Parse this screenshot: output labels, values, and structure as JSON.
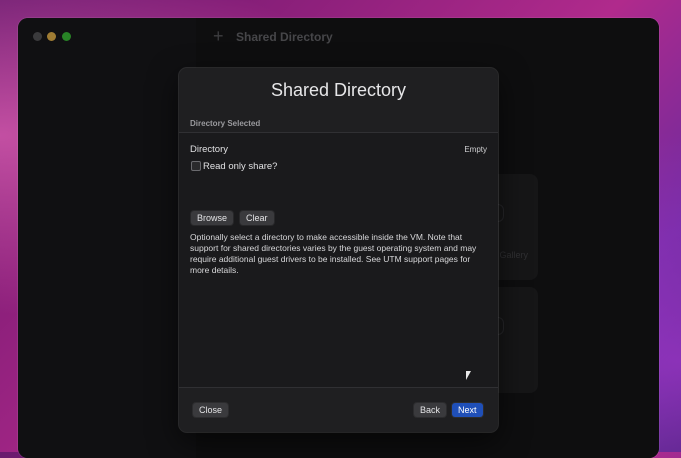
{
  "window": {
    "toolbar_title": "Shared Directory",
    "toolbar_add_symbol": "+"
  },
  "background_cards": [
    {
      "label": "Gallery"
    },
    {
      "label": ""
    }
  ],
  "dialog": {
    "title": "Shared Directory",
    "section_header": "Directory Selected",
    "directory_label": "Directory",
    "directory_value": "Empty",
    "read_only_label": "Read only share?",
    "read_only_checked": false,
    "browse_label": "Browse",
    "clear_label": "Clear",
    "help_text": "Optionally select a directory to make accessible inside the VM. Note that support for shared directories varies by the guest operating system and may require additional guest drivers to be installed. See UTM support pages for more details.",
    "close_label": "Close",
    "back_label": "Back",
    "next_label": "Next"
  },
  "colors": {
    "accent": "#1f4fb8",
    "traffic_close": "#5a5a5c",
    "traffic_minimize": "#f4bf4f",
    "traffic_maximize": "#3ec93b"
  }
}
